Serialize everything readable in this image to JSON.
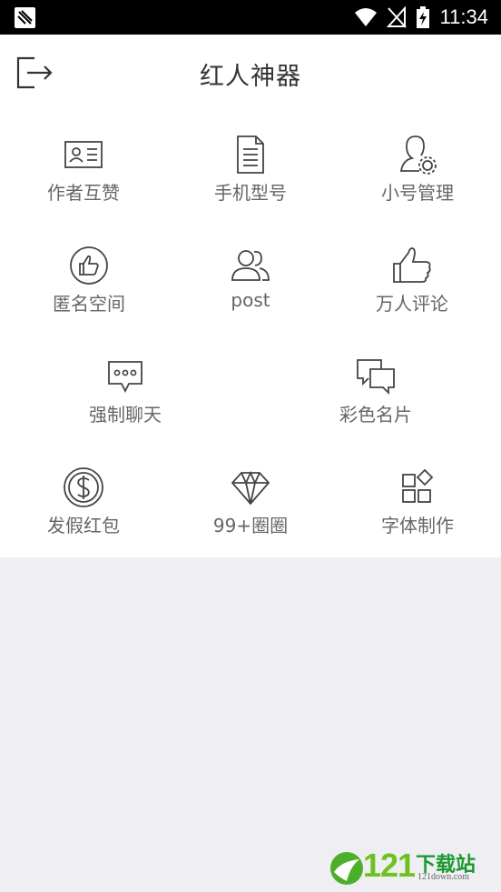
{
  "status_bar": {
    "time": "11:34"
  },
  "header": {
    "title": "红人神器"
  },
  "grid": {
    "row1": [
      {
        "label": "作者互赞",
        "icon": "id-card-icon"
      },
      {
        "label": "手机型号",
        "icon": "document-icon"
      },
      {
        "label": "小号管理",
        "icon": "user-settings-icon"
      }
    ],
    "row2": [
      {
        "label": "匿名空间",
        "icon": "thumbs-up-circle-icon"
      },
      {
        "label": "post",
        "icon": "users-icon"
      },
      {
        "label": "万人评论",
        "icon": "thumbs-up-icon"
      }
    ],
    "row3": [
      {
        "label": "强制聊天",
        "icon": "chat-bubble-icon"
      },
      {
        "label": "彩色名片",
        "icon": "messages-icon"
      }
    ],
    "row4": [
      {
        "label": "发假红包",
        "icon": "dollar-coin-icon"
      },
      {
        "label": "99+圈圈",
        "icon": "diamond-icon"
      },
      {
        "label": "字体制作",
        "icon": "apps-icon"
      }
    ]
  },
  "watermark": {
    "number": "121",
    "cn": "下载站",
    "sub": "121down.com"
  }
}
